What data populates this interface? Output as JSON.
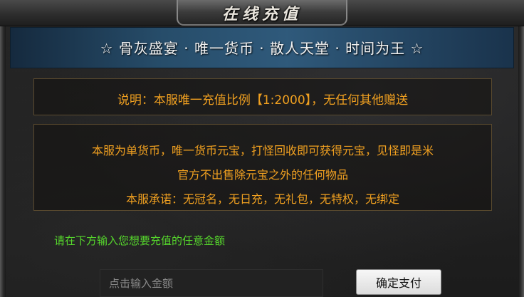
{
  "window": {
    "title": "在线充值"
  },
  "banner": {
    "text": "☆ 骨灰盛宴 · 唯一货币 · 散人天堂 · 时间为王 ☆"
  },
  "notice": {
    "text": "说明：本服唯一充值比例【1:2000】，无任何其他赠送"
  },
  "info": {
    "line1": "本服为单货币，唯一货币元宝，打怪回收即可获得元宝，见怪即是米",
    "line2": "官方不出售除元宝之外的任何物品",
    "line3": "本服承诺：无冠名，无日充，无礼包，无特权，无绑定"
  },
  "prompt": {
    "text": "请在下方输入您想要充值的任意金额"
  },
  "form": {
    "amount_value": "",
    "amount_placeholder": "点击输入金额",
    "submit_label": "确定支付"
  },
  "colors": {
    "notice_text": "#f0a020",
    "prompt_text": "#56d82c",
    "banner_bg": "#2f5e80",
    "box_border": "#5a4a2e"
  }
}
